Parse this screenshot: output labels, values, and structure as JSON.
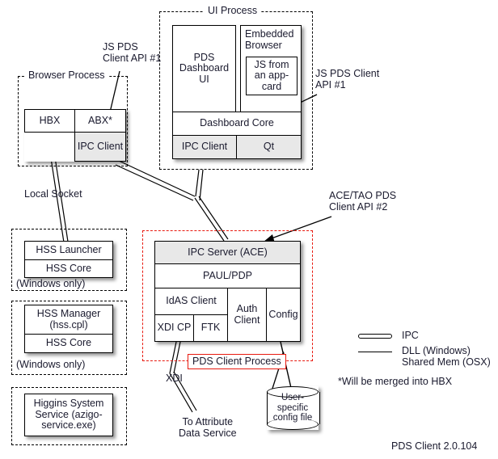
{
  "diagram": {
    "version_label": "PDS Client 2.0.104",
    "footnote": "*Will be merged into HBX"
  },
  "browser_process": {
    "title": "Browser Process",
    "boxes": {
      "hbx": "HBX",
      "abx": "ABX*",
      "ipc_client": "IPC\nClient"
    }
  },
  "ui_process": {
    "title": "UI Process",
    "boxes": {
      "pds_dashboard_ui": "PDS\nDashboard\nUI",
      "embedded_browser": "Embedded\nBrowser",
      "js_app_card": "JS from\nan app-\ncard",
      "dashboard_core": "Dashboard Core",
      "ipc_client": "IPC Client",
      "qt": "Qt"
    }
  },
  "pds_client_process": {
    "title": "PDS Client Process",
    "boxes": {
      "ipc_server": "IPC Server (ACE)",
      "paul_pdp": "PAUL/PDP",
      "idas_client": "IdAS Client",
      "xdi_cp": "XDI CP",
      "ftk": "FTK",
      "auth_client": "Auth\nClient",
      "config": "Config"
    }
  },
  "hss_launcher_process": {
    "platform_note": "(Windows only)",
    "boxes": {
      "hss_launcher": "HSS Launcher",
      "hss_core": "HSS Core"
    }
  },
  "hss_manager_process": {
    "platform_note": "(Windows only)",
    "boxes": {
      "hss_manager": "HSS Manager\n(hss.cpl)",
      "hss_core": "HSS Core"
    }
  },
  "higgins_service_process": {
    "boxes": {
      "higgins_system_service": "Higgins System\nService (azigo-\nservice.exe)"
    }
  },
  "annotations": {
    "js_pds_client_api_left": "JS PDS\nClient API #1",
    "js_pds_client_api_right": "JS PDS Client\nAPI #1",
    "ace_tao_pds_client_api": "ACE/TAO PDS\nClient API #2",
    "local_socket": "Local Socket",
    "xdi": "XDI",
    "to_attribute_data_service": "To Attribute\nData Service"
  },
  "datastore": {
    "user_config_file": "User-\nspecific\nconfig file"
  },
  "legend": {
    "ipc": "IPC",
    "dll_shared_mem": "DLL (Windows)\nShared Mem (OSX)"
  },
  "colors": {
    "red_accent": "#e8190f",
    "box_gray": "#e8e8e8",
    "text": "#1a1a2e"
  }
}
